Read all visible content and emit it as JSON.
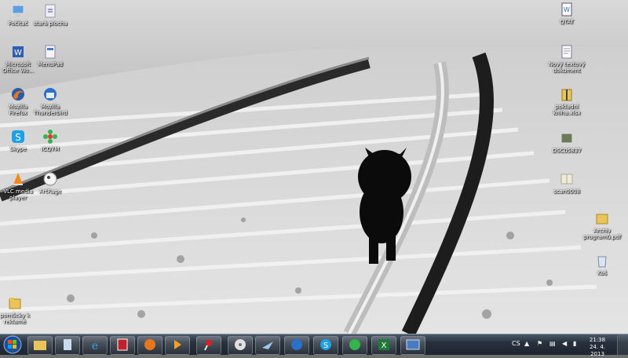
{
  "desktop": {
    "icons": [
      {
        "label": "Počítač",
        "icon": "computer-icon"
      },
      {
        "label": "stará plocha",
        "icon": "folder-shortcut-icon"
      },
      {
        "label": "Microsoft\nOffice Wo...",
        "icon": "word-icon"
      },
      {
        "label": "MenuPad",
        "icon": "document-icon"
      },
      {
        "label": "Mozilla\nFirefox",
        "icon": "firefox-icon"
      },
      {
        "label": "Mozilla\nThunderbird",
        "icon": "thunderbird-icon"
      },
      {
        "label": "Skype",
        "icon": "skype-icon"
      },
      {
        "label": "ICQ7M",
        "icon": "icq-icon"
      },
      {
        "label": "VLC media\nplayer",
        "icon": "vlc-icon"
      },
      {
        "label": "ArtRage",
        "icon": "artrage-icon"
      },
      {
        "label": "pomůcky k\nreklamě",
        "icon": "folder-icon"
      }
    ],
    "right_icons": [
      {
        "label": "QTAT",
        "icon": "word-doc-icon"
      },
      {
        "label": "Nový textový\ndokument",
        "icon": "text-doc-icon"
      },
      {
        "label": "pokladní\nkniha.xlsx",
        "icon": "archive-icon"
      },
      {
        "label": "DSC05837",
        "icon": "photo-icon"
      },
      {
        "label": "scan0008",
        "icon": "book-icon"
      },
      {
        "label": "Archiv\nprogramů.pdf",
        "icon": "folder-icon"
      },
      {
        "label": "Koš",
        "icon": "recycle-bin-icon"
      }
    ]
  },
  "taskbar": {
    "start_label": "Start",
    "pinned": [
      {
        "icon": "explorer-icon"
      },
      {
        "icon": "notepad-icon"
      },
      {
        "icon": "ie-icon"
      },
      {
        "icon": "red-app-icon"
      },
      {
        "icon": "firefox-icon"
      },
      {
        "icon": "media-player-icon"
      },
      {
        "icon": "pin-icon"
      },
      {
        "icon": "cd-icon"
      },
      {
        "icon": "mercury-icon"
      },
      {
        "icon": "thunderbird-icon"
      },
      {
        "icon": "skype-icon"
      },
      {
        "icon": "icq-icon"
      },
      {
        "icon": "excel-icon"
      },
      {
        "icon": "desktop-window-icon"
      }
    ],
    "tray": {
      "language": "CS",
      "time": "21:38",
      "date": "24. 4. 2013"
    }
  },
  "colors": {
    "taskbar": "#27313d",
    "firefox": "#e8761c",
    "skype": "#1ea0e6",
    "icq": "#35b44a"
  }
}
